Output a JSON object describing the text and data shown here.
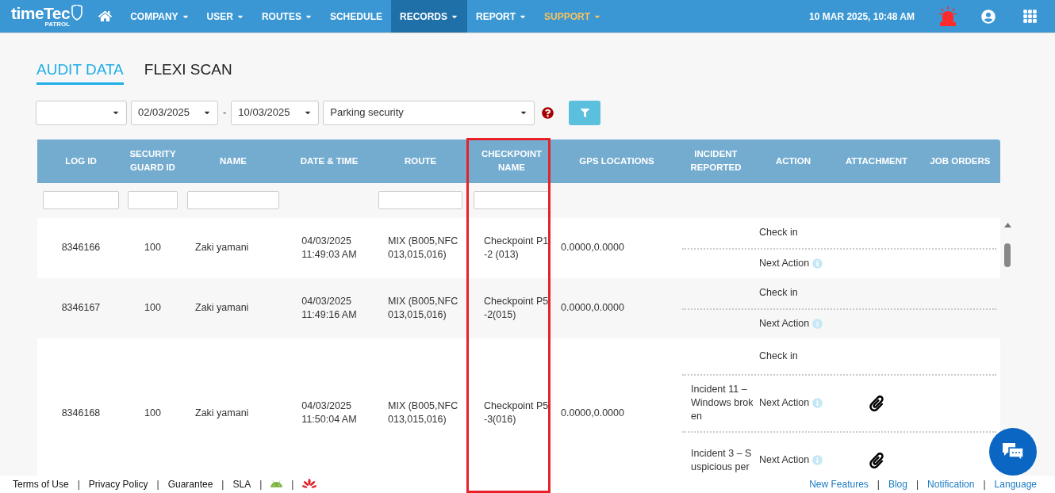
{
  "logo": {
    "name": "timeTec",
    "sub": "PATROL"
  },
  "nav": [
    {
      "label": "COMPANY",
      "dropdown": true,
      "selected": false,
      "accent": false
    },
    {
      "label": "USER",
      "dropdown": true,
      "selected": false,
      "accent": false
    },
    {
      "label": "ROUTES",
      "dropdown": true,
      "selected": false,
      "accent": false
    },
    {
      "label": "SCHEDULE",
      "dropdown": false,
      "selected": false,
      "accent": false
    },
    {
      "label": "RECORDS",
      "dropdown": true,
      "selected": true,
      "accent": false
    },
    {
      "label": "REPORT",
      "dropdown": true,
      "selected": false,
      "accent": false
    },
    {
      "label": "SUPPORT",
      "dropdown": true,
      "selected": false,
      "accent": true
    }
  ],
  "datetime": "10 MAR 2025, 10:48 AM",
  "tabs": [
    {
      "label": "AUDIT DATA",
      "selected": true
    },
    {
      "label": "FLEXI SCAN",
      "selected": false
    }
  ],
  "filters": {
    "date_from": "02/03/2025",
    "separator": "-",
    "date_to": "10/03/2025",
    "route": "Parking security"
  },
  "table": {
    "columns": [
      {
        "label": "LOG ID",
        "filter": true,
        "highlighted": false
      },
      {
        "label": "SECURITY GUARD ID",
        "filter": true,
        "highlighted": false
      },
      {
        "label": "NAME",
        "filter": true,
        "highlighted": false
      },
      {
        "label": "DATE & TIME",
        "filter": false,
        "highlighted": false
      },
      {
        "label": "ROUTE",
        "filter": true,
        "highlighted": false
      },
      {
        "label": "CHECKPOINT NAME",
        "filter": true,
        "highlighted": true
      },
      {
        "label": "GPS LOCATIONS",
        "filter": false,
        "highlighted": false
      },
      {
        "label": "INCIDENT REPORTED",
        "filter": false,
        "highlighted": false
      },
      {
        "label": "ACTION",
        "filter": false,
        "highlighted": false
      },
      {
        "label": "ATTACHMENT",
        "filter": false,
        "highlighted": false
      },
      {
        "label": "JOB ORDERS",
        "filter": false,
        "highlighted": false
      }
    ],
    "rows": [
      {
        "log_id": "8346166",
        "guard_id": "100",
        "name": "Zaki yamani",
        "date": "04/03/2025",
        "time": "11:49:03 AM",
        "route": "MIX (B005,NFC 013,015,016)",
        "checkpoint": "Checkpoint P1-2 (013)",
        "gps": "0.0000,0.0000",
        "entries": [
          {
            "action": "Check in",
            "info": false,
            "attachment": false
          },
          {
            "action": "Next Action",
            "info": true,
            "attachment": false
          }
        ]
      },
      {
        "log_id": "8346167",
        "guard_id": "100",
        "name": "Zaki yamani",
        "date": "04/03/2025",
        "time": "11:49:16 AM",
        "route": "MIX (B005,NFC 013,015,016)",
        "checkpoint": "Checkpoint P5-2(015)",
        "gps": "0.0000,0.0000",
        "entries": [
          {
            "action": "Check in",
            "info": false,
            "attachment": false
          },
          {
            "action": "Next Action",
            "info": true,
            "attachment": false
          }
        ]
      },
      {
        "log_id": "8346168",
        "guard_id": "100",
        "name": "Zaki yamani",
        "date": "04/03/2025",
        "time": "11:50:04 AM",
        "route": "MIX (B005,NFC 013,015,016)",
        "checkpoint": "Checkpoint P5-3(016)",
        "gps": "0.0000,0.0000",
        "entries": [
          {
            "action": "Check in",
            "info": false,
            "attachment": false
          },
          {
            "incident": "Incident 11 – Windows broken",
            "action": "Next Action",
            "info": true,
            "attachment": true
          },
          {
            "incident": "Incident 3 – Suspicious per",
            "action": "Next Action",
            "info": true,
            "attachment": true
          }
        ]
      }
    ]
  },
  "footer": {
    "separator": "|",
    "left": [
      "Terms of Use",
      "Privacy Policy",
      "Guarantee",
      "SLA"
    ],
    "right": [
      "New Features",
      "Blog",
      "Notification",
      "Language"
    ]
  }
}
